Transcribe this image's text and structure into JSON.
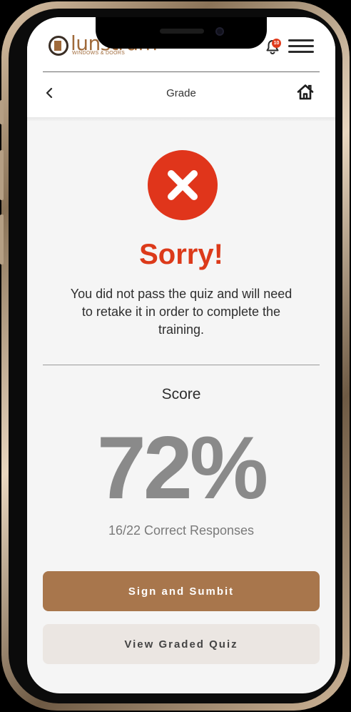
{
  "brand": {
    "name": "lunstrum",
    "tagline": "WINDOWS & DOORS"
  },
  "header": {
    "notification_count": "10",
    "title": "Grade",
    "back_icon": "chevron-left-icon",
    "home_icon": "home-icon",
    "bell_icon": "bell-icon",
    "menu_icon": "hamburger-menu-icon"
  },
  "result": {
    "status_icon": "x-circle-icon",
    "headline": "Sorry!",
    "message": "You did not pass the quiz and will need to retake it in order to complete the training.",
    "score_label": "Score",
    "score": "72%",
    "responses": "16/22 Correct Responses"
  },
  "actions": {
    "primary_label": "Sign and Sumbit",
    "secondary_label": "View Graded Quiz"
  },
  "colors": {
    "error_red": "#e0351b",
    "brand_brown": "#a8764c",
    "secondary_button": "#ebe6e2",
    "score_gray": "#8a8a8a"
  }
}
